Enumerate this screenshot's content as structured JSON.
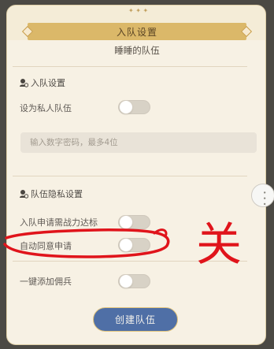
{
  "dialog": {
    "title": "入队设置"
  },
  "team": {
    "name": "睡睡的队伍"
  },
  "sections": {
    "join": {
      "title": "入队设置"
    },
    "privacy": {
      "title": "队伍隐私设置"
    }
  },
  "rows": {
    "private_team": {
      "label": "设为私人队伍",
      "on": false
    },
    "power_requirement": {
      "label": "入队申请需战力达标",
      "on": false
    },
    "auto_accept": {
      "label": "自动同意申请",
      "on": false
    },
    "add_mercenary": {
      "label": "一键添加佣兵",
      "on": false
    }
  },
  "password": {
    "placeholder": "输入数字密码，最多4位",
    "value": ""
  },
  "buttons": {
    "create": "创建队伍"
  },
  "annotation": {
    "text": "关",
    "color": "#e0141b"
  },
  "colors": {
    "panel_bg": "#f7f1e4",
    "title_bar": "#dbb869",
    "button_bg": "#4f6fa6",
    "toggle_off": "#d8d2c6"
  }
}
